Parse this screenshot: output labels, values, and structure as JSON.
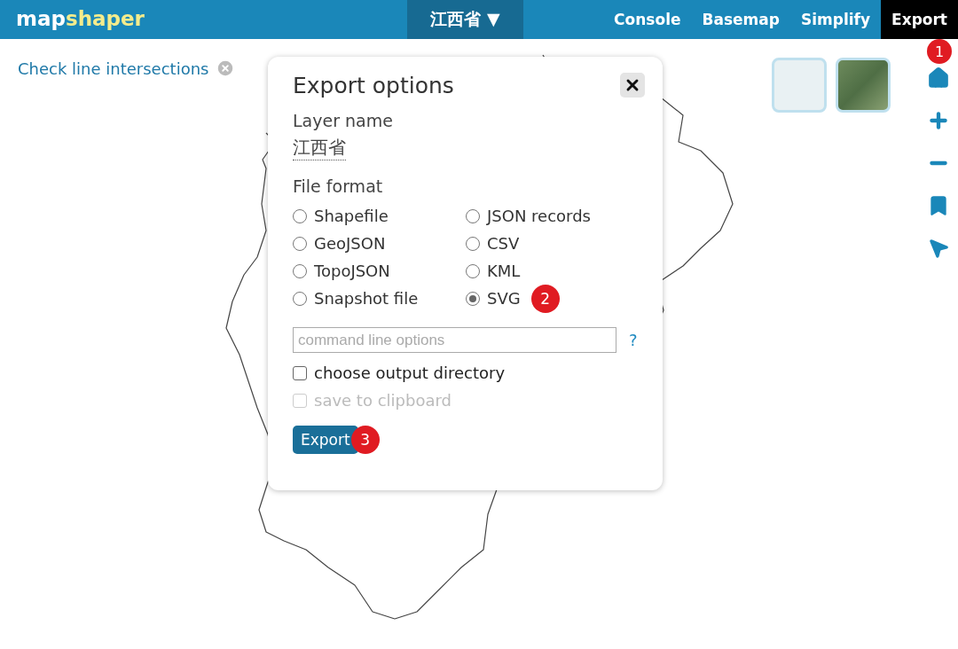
{
  "header": {
    "logo_parts": [
      "map",
      "shaper"
    ],
    "layer_menu": {
      "label": "江西省",
      "caret": "▼"
    },
    "nav": [
      {
        "label": "Console",
        "selected": false
      },
      {
        "label": "Basemap",
        "selected": false
      },
      {
        "label": "Simplify",
        "selected": false
      },
      {
        "label": "Export",
        "selected": true,
        "callout": "1"
      }
    ]
  },
  "notice": {
    "label": "Check line intersections"
  },
  "dialog": {
    "title": "Export options",
    "layer_label": "Layer name",
    "layer_value": "江西省",
    "format_label": "File format",
    "formats": [
      {
        "label": "Shapefile",
        "selected": false
      },
      {
        "label": "JSON records",
        "selected": false
      },
      {
        "label": "GeoJSON",
        "selected": false
      },
      {
        "label": "CSV",
        "selected": false
      },
      {
        "label": "TopoJSON",
        "selected": false
      },
      {
        "label": "KML",
        "selected": false
      },
      {
        "label": "Snapshot file",
        "selected": false
      },
      {
        "label": "SVG",
        "selected": true,
        "callout": "2"
      }
    ],
    "options_placeholder": "command line options",
    "help": "?",
    "checkboxes": [
      {
        "label": "choose output directory",
        "checked": false,
        "disabled": false
      },
      {
        "label": "save to clipboard",
        "checked": false,
        "disabled": true
      }
    ],
    "button": {
      "label": "Export",
      "callout": "3"
    }
  }
}
